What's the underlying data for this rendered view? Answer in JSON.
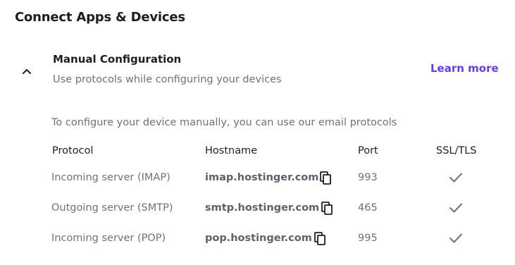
{
  "page": {
    "title": "Connect Apps & Devices"
  },
  "section": {
    "title": "Manual Configuration",
    "subtitle": "Use protocols while configuring your devices",
    "learn_more": "Learn more",
    "intro": "To configure your device manually, you can use our email protocols"
  },
  "table": {
    "headers": {
      "protocol": "Protocol",
      "hostname": "Hostname",
      "port": "Port",
      "ssl": "SSL/TLS"
    },
    "rows": [
      {
        "protocol": "Incoming server (IMAP)",
        "hostname": "imap.hostinger.com",
        "port": "993",
        "ssl": true
      },
      {
        "protocol": "Outgoing server (SMTP)",
        "hostname": "smtp.hostinger.com",
        "port": "465",
        "ssl": true
      },
      {
        "protocol": "Incoming server (POP)",
        "hostname": "pop.hostinger.com",
        "port": "995",
        "ssl": true
      }
    ]
  },
  "icons": {
    "collapse": "chevron-up-icon",
    "copy": "copy-icon",
    "check": "check-icon"
  },
  "colors": {
    "accent": "#673de6",
    "text": "#1d1e20",
    "muted": "#6d7081"
  }
}
